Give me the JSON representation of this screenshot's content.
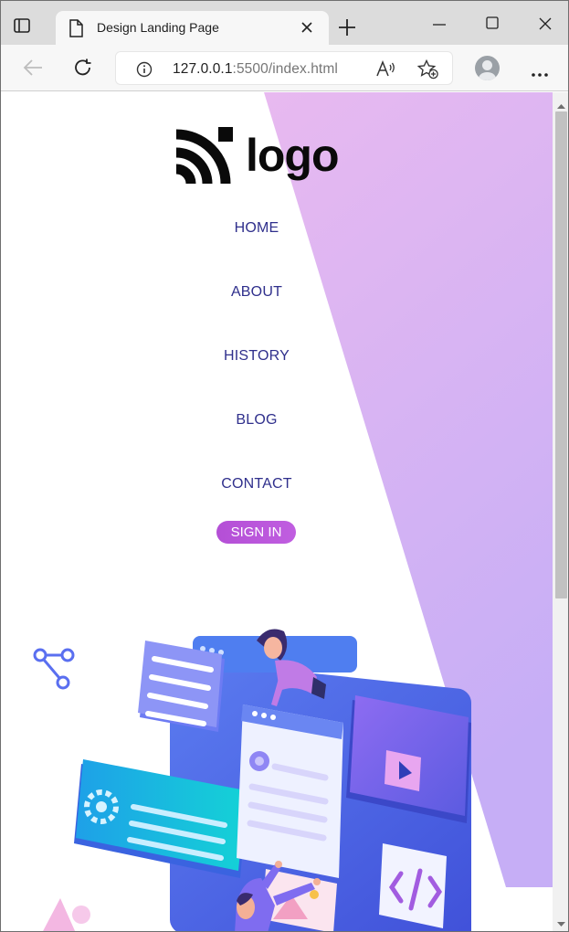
{
  "browser": {
    "tab_title": "Design Landing Page",
    "url_host": "127.0.0.1",
    "url_rest": ":5500/index.html",
    "icons": [
      "tab-actions-icon",
      "document-icon",
      "close-icon",
      "new-tab-icon",
      "minimize-icon",
      "maximize-icon",
      "window-close-icon",
      "back-icon",
      "refresh-icon",
      "info-icon",
      "read-aloud-icon",
      "favorites-icon",
      "profile-avatar",
      "more-menu-icon"
    ]
  },
  "page": {
    "logo_text": "logo",
    "nav": [
      "HOME",
      "ABOUT",
      "HISTORY",
      "BLOG",
      "CONTACT"
    ],
    "signin_label": "SIGN IN"
  },
  "colors": {
    "nav_text": "#2f2f8c",
    "gradient_top": "#e8b9f0",
    "gradient_bottom": "#c6aef6",
    "signin": "#b44fd6"
  }
}
